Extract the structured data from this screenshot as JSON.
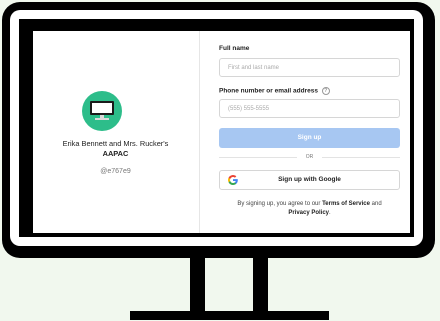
{
  "profile": {
    "name_line1": "Erika Bennett and Mrs. Rucker's",
    "name_line2": "AAPAC",
    "handle": "@e767e9"
  },
  "form": {
    "full_name_label": "Full name",
    "full_name_placeholder": "First and last name",
    "contact_label": "Phone number or email address",
    "contact_placeholder": "(555) 555-5555",
    "signup_label": "Sign up",
    "or_label": "OR",
    "google_label": "Sign up with Google",
    "terms_prefix": "By signing up, you agree to our ",
    "terms_link": "Terms of Service",
    "terms_mid": " and ",
    "privacy_link": "Privacy Policy",
    "terms_suffix": "."
  },
  "colors": {
    "avatar_bg": "#2dbd8a",
    "signup_bg": "#a7c7f2",
    "background": "#f1f8ee"
  }
}
